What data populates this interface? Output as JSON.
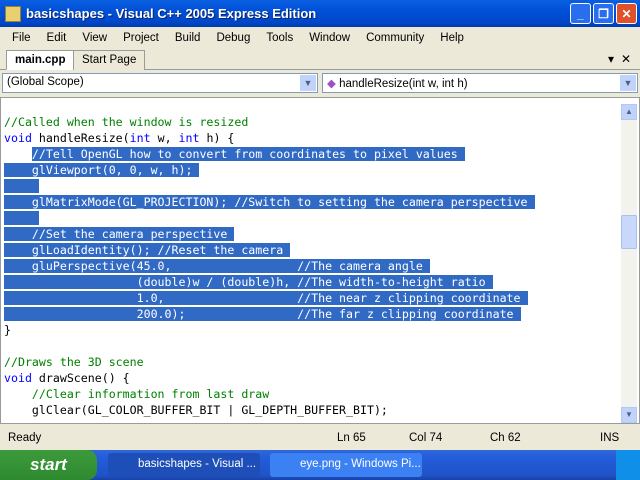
{
  "window": {
    "title": "basicshapes - Visual C++ 2005 Express Edition"
  },
  "menu": [
    "File",
    "Edit",
    "View",
    "Project",
    "Build",
    "Debug",
    "Tools",
    "Window",
    "Community",
    "Help"
  ],
  "tabs": {
    "active": "main.cpp",
    "other": "Start Page"
  },
  "scope": {
    "left": "(Global Scope)",
    "right": "handleResize(int w, int h)"
  },
  "code": [
    {
      "segs": [
        {
          "t": "//Called when the window is resized",
          "c": "cm"
        }
      ]
    },
    {
      "segs": [
        {
          "t": "void",
          "c": "kw"
        },
        {
          "t": " handleResize("
        },
        {
          "t": "int",
          "c": "kw"
        },
        {
          "t": " w, "
        },
        {
          "t": "int",
          "c": "kw"
        },
        {
          "t": " h) {"
        }
      ]
    },
    {
      "pre": "    ",
      "sel": "//Tell OpenGL how to convert from coordinates to pixel values"
    },
    {
      "sel": "    glViewport(0, 0, w, h);"
    },
    {
      "sel": "    "
    },
    {
      "sel": "    glMatrixMode(GL_PROJECTION); //Switch to setting the camera perspective"
    },
    {
      "sel": "    "
    },
    {
      "sel": "    //Set the camera perspective"
    },
    {
      "sel": "    glLoadIdentity(); //Reset the camera"
    },
    {
      "sel": "    gluPerspective(45.0,                  //The camera angle"
    },
    {
      "sel": "                   (double)w / (double)h, //The width-to-height ratio"
    },
    {
      "sel": "                   1.0,                   //The near z clipping coordinate"
    },
    {
      "sel": "                   200.0);                //The far z clipping coordinate"
    },
    {
      "segs": [
        {
          "t": "}"
        }
      ]
    },
    {
      "segs": [
        {
          "t": ""
        }
      ]
    },
    {
      "segs": [
        {
          "t": "//Draws the 3D scene",
          "c": "cm"
        }
      ]
    },
    {
      "segs": [
        {
          "t": "void",
          "c": "kw"
        },
        {
          "t": " drawScene() {"
        }
      ]
    },
    {
      "segs": [
        {
          "t": "    "
        },
        {
          "t": "//Clear information from last draw",
          "c": "cm"
        }
      ]
    },
    {
      "segs": [
        {
          "t": "    glClear(GL_COLOR_BUFFER_BIT | GL_DEPTH_BUFFER_BIT);"
        }
      ]
    }
  ],
  "status": {
    "text": "Ready",
    "ln": "Ln 65",
    "col": "Col 74",
    "ch": "Ch 62",
    "mode": "INS"
  },
  "taskbar": {
    "start": "start",
    "items": [
      "basicshapes - Visual ...",
      "eye.png - Windows Pi..."
    ]
  }
}
